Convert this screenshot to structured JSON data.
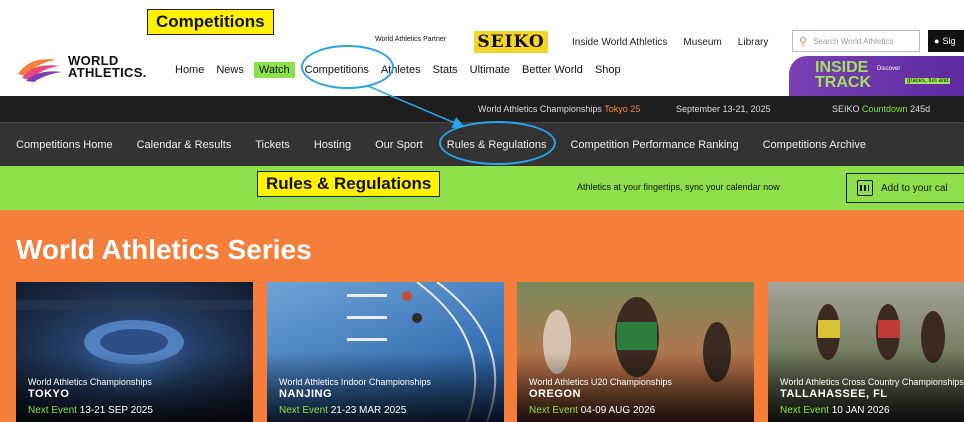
{
  "annotations": {
    "competitions_label": "Competitions",
    "rules_label": "Rules & Regulations"
  },
  "header": {
    "logo_line1": "WORLD",
    "logo_line2": "ATHLETICS.",
    "partner_text": "World Athletics Partner",
    "partner_brand": "SEIKO",
    "top_links": [
      "Inside World Athletics",
      "Museum",
      "Library"
    ],
    "search_placeholder": "Search World Athletics",
    "signin_label": "Sig",
    "main_nav": [
      "Home",
      "News",
      "Watch",
      "Competitions",
      "Athletes",
      "Stats",
      "Ultimate",
      "Better World",
      "Shop"
    ],
    "promo": {
      "title_line1": "INSIDE",
      "title_line2": "TRACK",
      "text1": "Discover",
      "text2": "graces, fun and"
    }
  },
  "strip": {
    "event_prefix": "World Athletics Championships",
    "event_city": "Tokyo 25",
    "dates": "September 13-21, 2025",
    "countdown_brand": "SEIKO",
    "countdown_label": "Countdown",
    "countdown_value": "245d"
  },
  "competitions_nav": [
    "Competitions Home",
    "Calendar & Results",
    "Tickets",
    "Hosting",
    "Our Sport",
    "Rules & Regulations",
    "Competition Performance Ranking",
    "Competitions Archive"
  ],
  "green_bar": {
    "sync_text": "Athletics at your fingertips, sync your calendar now",
    "add_calendar": "Add to your cal"
  },
  "series": {
    "heading": "World Athletics Series",
    "next_label": "Next Event",
    "cards": [
      {
        "name": "World Athletics Championships",
        "city": "TOKYO",
        "date": "13-21 SEP 2025"
      },
      {
        "name": "World Athletics Indoor Championships",
        "city": "NANJING",
        "date": "21-23 MAR 2025"
      },
      {
        "name": "World Athletics U20 Championships",
        "city": "OREGON",
        "date": "04-09 AUG 2026"
      },
      {
        "name": "World Athletics Cross Country Championships",
        "city": "TALLAHASSEE, FL",
        "date": "10 JAN 2026"
      }
    ]
  }
}
